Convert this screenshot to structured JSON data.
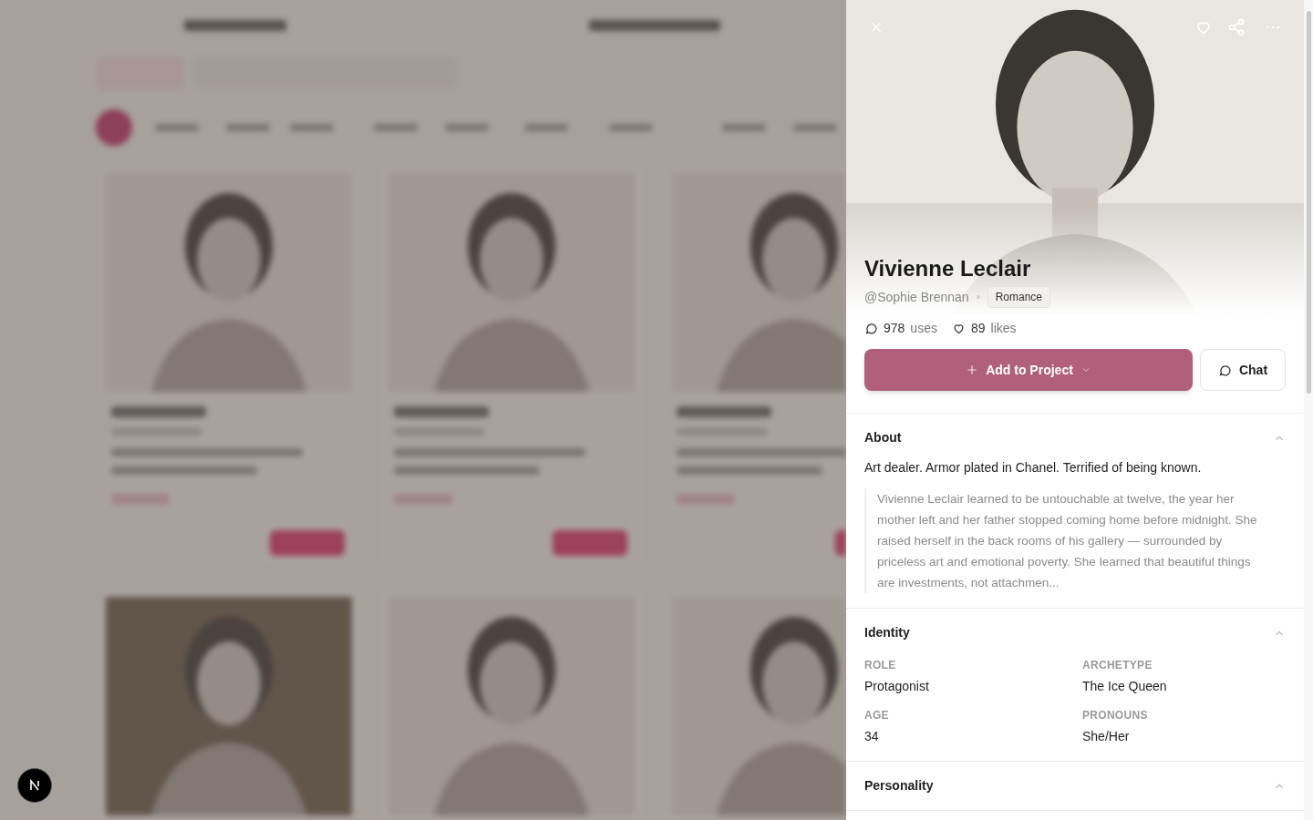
{
  "panel": {
    "title": "Vivienne Leclair",
    "author": "@Sophie Brennan",
    "genre_tag": "Romance",
    "stats": [
      {
        "kind": "uses",
        "value": "978",
        "label": "uses"
      },
      {
        "kind": "likes",
        "value": "89",
        "label": "likes"
      }
    ],
    "primary_button": "Add to Project",
    "secondary_button": "Chat",
    "sections": [
      {
        "title": "About",
        "expanded": true,
        "tagline": "Art dealer. Armor plated in Chanel. Terrified of being known.",
        "excerpt": "Vivienne Leclair learned to be untouchable at twelve, the year her mother left and her father stopped coming home before midnight. She raised herself in the back rooms of his gallery — surrounded by priceless art and emotional poverty. She learned that beautiful things are investments, not attachmen..."
      },
      {
        "title": "Identity",
        "expanded": true,
        "fields": [
          {
            "label": "ROLE",
            "value": "Protagonist"
          },
          {
            "label": "ARCHETYPE",
            "value": "The Ice Queen"
          },
          {
            "label": "AGE",
            "value": "34"
          },
          {
            "label": "PRONOUNS",
            "value": "She/Her"
          }
        ]
      },
      {
        "title": "Personality",
        "expanded": true
      }
    ]
  }
}
